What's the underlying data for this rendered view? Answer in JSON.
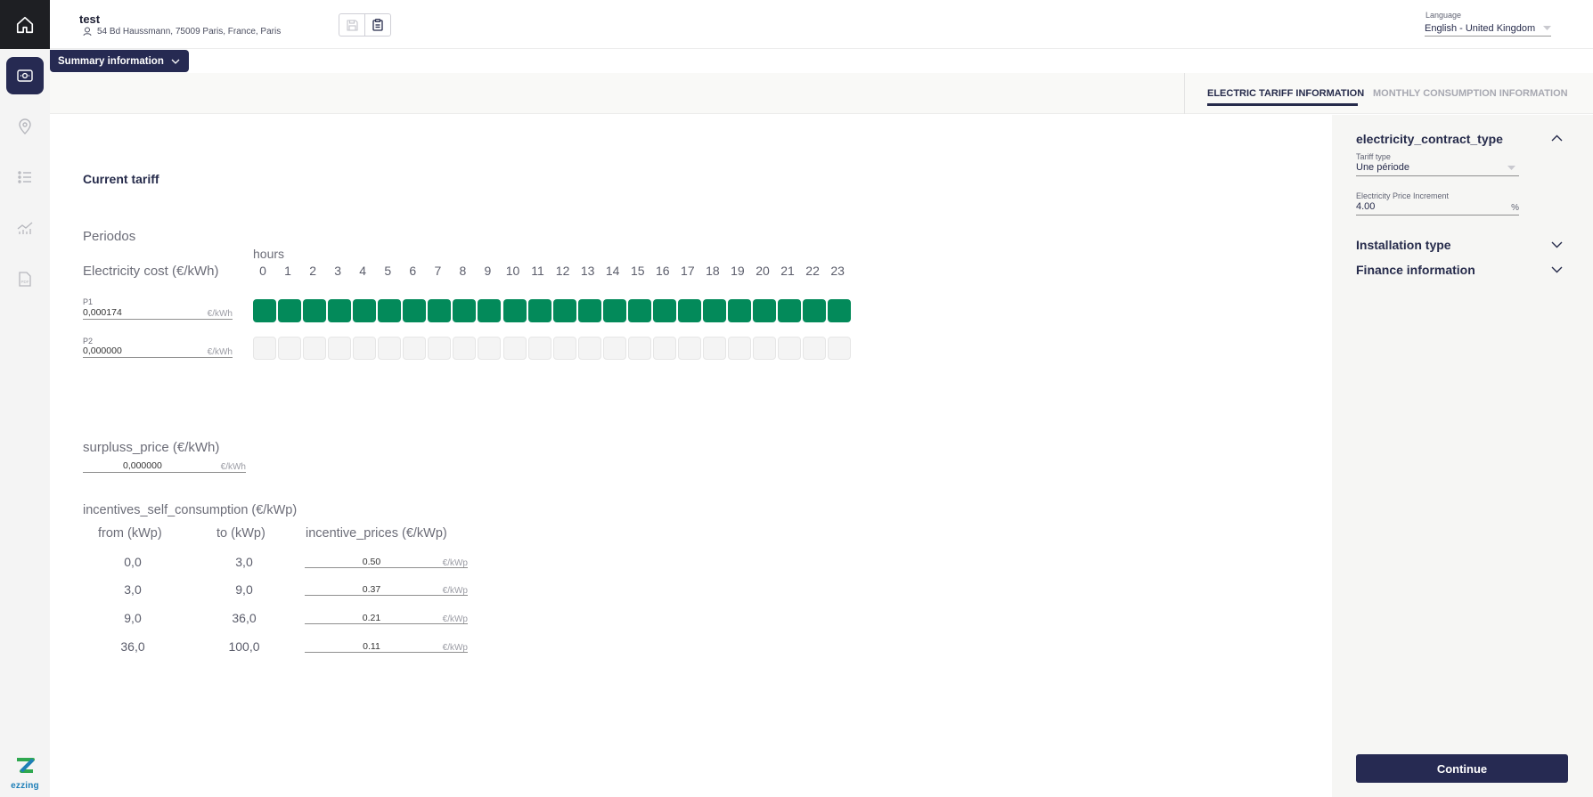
{
  "header": {
    "project_name": "test",
    "address": "54 Bd Haussmann, 75009 Paris, France, Paris",
    "language_label": "Language",
    "language_value": "English - United Kingdom"
  },
  "summary_button": {
    "label": "Summary information"
  },
  "tabs": [
    {
      "label": "ELECTRIC TARIFF INFORMATION",
      "active": true
    },
    {
      "label": "MONTHLY CONSUMPTION INFORMATION",
      "active": false
    }
  ],
  "tariff": {
    "title": "Current tariff",
    "periodos_label": "Periodos",
    "hours_label": "hours",
    "cost_label": "Electricity cost (€/kWh)",
    "hours": [
      "0",
      "1",
      "2",
      "3",
      "4",
      "5",
      "6",
      "7",
      "8",
      "9",
      "10",
      "11",
      "12",
      "13",
      "14",
      "15",
      "16",
      "17",
      "18",
      "19",
      "20",
      "21",
      "22",
      "23"
    ],
    "periods": [
      {
        "name": "P1",
        "value": "0,000174",
        "unit": "€/kWh",
        "active_hours": [
          0,
          1,
          2,
          3,
          4,
          5,
          6,
          7,
          8,
          9,
          10,
          11,
          12,
          13,
          14,
          15,
          16,
          17,
          18,
          19,
          20,
          21,
          22,
          23
        ]
      },
      {
        "name": "P2",
        "value": "0,000000",
        "unit": "€/kWh",
        "active_hours": []
      }
    ],
    "active_color": "#038a5a"
  },
  "surplus": {
    "label": "surpluss_price (€/kWh)",
    "value": "0,000000",
    "unit": "€/kWh"
  },
  "incentives": {
    "label": "incentives_self_consumption (€/kWp)",
    "col_from": "from (kWp)",
    "col_to": "to (kWp)",
    "col_price": "incentive_prices (€/kWp)",
    "unit": "€/kWp",
    "rows": [
      {
        "from": "0,0",
        "to": "3,0",
        "price": "0.50"
      },
      {
        "from": "3,0",
        "to": "9,0",
        "price": "0.37"
      },
      {
        "from": "9,0",
        "to": "36,0",
        "price": "0.21"
      },
      {
        "from": "36,0",
        "to": "100,0",
        "price": "0.11"
      }
    ]
  },
  "right_panel": {
    "section1_title": "electricity_contract_type",
    "tariff_type_label": "Tariff type",
    "tariff_type_value": "Une période",
    "price_increment_label": "Electricity Price Increment",
    "price_increment_value": "4.00",
    "price_increment_unit": "%",
    "section2_title": "Installation type",
    "section3_title": "Finance information",
    "continue_label": "Continue"
  },
  "brand": {
    "logo_text": "ezzing"
  }
}
